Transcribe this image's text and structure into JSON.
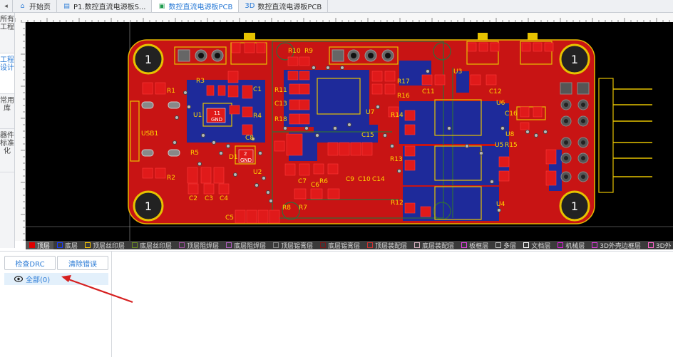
{
  "tabs": [
    {
      "label": "开始页",
      "icon": "home-icon"
    },
    {
      "label": "P1.数控直流电源板S...",
      "icon": "schematic-icon"
    },
    {
      "label": "数控直流电源板PCB",
      "icon": "pcb-icon",
      "active": true
    },
    {
      "label": "数控直流电源板PCB",
      "icon": "3d-icon",
      "prefix": "3D"
    }
  ],
  "sidebar": {
    "items": [
      "所有工程",
      "工程设计",
      "常用库",
      "器件标准化"
    ]
  },
  "pcb": {
    "mount_holes": [
      "1",
      "1",
      "1",
      "1"
    ],
    "labels": {
      "usb": "USB1",
      "r1": "R1",
      "r3": "R3",
      "r4": "R4",
      "r5": "R5",
      "r2": "R2",
      "c1": "C1",
      "c2": "C2",
      "c3": "C3",
      "c4": "C4",
      "c5": "C5",
      "c6": "C6",
      "c7": "C7",
      "c8": "C8",
      "c9": "C9",
      "c10": "C10",
      "c11": "C11",
      "c12": "C12",
      "c13": "C13",
      "c14": "C14",
      "c15": "C15",
      "c16": "C16",
      "r6": "R6",
      "r7": "R7",
      "r8": "R8",
      "r9": "R9",
      "r10": "R10",
      "r11": "R11",
      "r12": "R12",
      "r13": "R13",
      "r14": "R14",
      "r15": "R15",
      "r16": "R16",
      "r17": "R17",
      "r18": "R18",
      "u1": "U1",
      "u2": "U2",
      "u3": "U3",
      "u4": "U4",
      "u5": "U5",
      "u6": "U6",
      "u7": "U7",
      "u8": "U8",
      "d1": "D1",
      "gnd1": "GND",
      "gnd2": "GND",
      "n11": "11",
      "n2": "2"
    }
  },
  "layers": [
    {
      "name": "顶层",
      "color": "#e00000",
      "active": true
    },
    {
      "name": "底层",
      "color": "#1a3cff"
    },
    {
      "name": "顶层丝印层",
      "color": "#ffcc00"
    },
    {
      "name": "底层丝印层",
      "color": "#6b8e23"
    },
    {
      "name": "顶层阻焊层",
      "color": "#a050a0"
    },
    {
      "name": "底层阻焊层",
      "color": "#b060c0"
    },
    {
      "name": "顶层锡膏层",
      "color": "#888888"
    },
    {
      "name": "底层锡膏层",
      "color": "#7a1a1a"
    },
    {
      "name": "顶层装配层",
      "color": "#cc3333"
    },
    {
      "name": "底层装配层",
      "color": "#d8b0c0"
    },
    {
      "name": "板框层",
      "color": "#e040e0"
    },
    {
      "name": "多层",
      "color": "#c0c0c0"
    },
    {
      "name": "文档层",
      "color": "#ffffff"
    },
    {
      "name": "机械层",
      "color": "#e020e0"
    },
    {
      "name": "3D外壳边框层",
      "color": "#e03ae0"
    },
    {
      "name": "3D外",
      "color": "#ff66cc"
    }
  ],
  "drc": {
    "check_label": "检查DRC",
    "clear_label": "清除错误",
    "all_label": "全部(0)"
  }
}
